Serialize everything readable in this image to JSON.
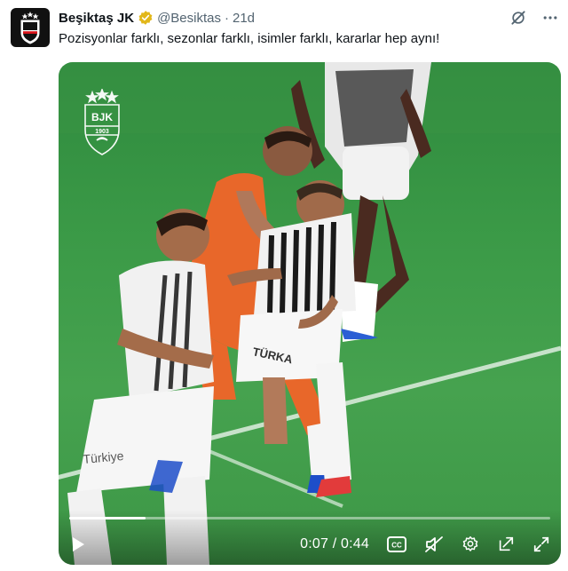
{
  "tweet": {
    "author_name": "Beşiktaş JK",
    "handle": "@Besiktas",
    "separator": "·",
    "time": "21d",
    "text": "Pozisyonlar farklı, sezonlar farklı, isimler farklı, kararlar hep aynı!",
    "verified_color": "#e2b719"
  },
  "video": {
    "elapsed": "0:07",
    "separator": " / ",
    "duration": "0:44",
    "progress_fraction": 0.159,
    "crest_letters": "BJK",
    "crest_year": "1903"
  },
  "icons": [
    "grok-icon",
    "more-icon",
    "play-icon",
    "captions-icon",
    "mute-icon",
    "settings-icon",
    "pop-out-icon",
    "fullscreen-icon"
  ]
}
